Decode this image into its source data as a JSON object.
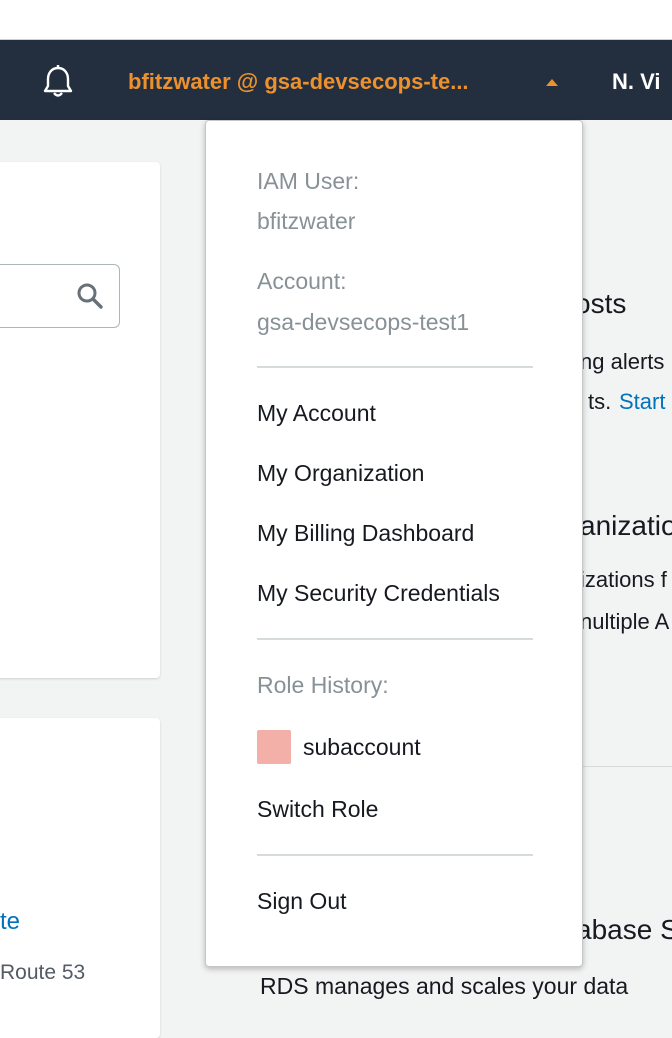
{
  "topnav": {
    "account_label": "bfitzwater @ gsa-devsecops-te...",
    "region_label": "N. Vi",
    "accent_color": "#ec912d",
    "background_color": "#232f3e"
  },
  "icons": {
    "notifications": "bell-icon",
    "search": "search-icon",
    "expand": "caret-up-icon"
  },
  "background": {
    "costs_heading": "osts",
    "costs_line1": "ng alerts",
    "costs_line2": "ts.",
    "costs_link": "Start",
    "org_heading": "anizatio",
    "org_line1": "izations f",
    "org_line2": "nultiple A",
    "link_fragment": "te",
    "route_fragment": "Route 53",
    "db_heading": "abase S",
    "rds_text": "RDS manages and scales your data"
  },
  "dropdown": {
    "iam_user_label": "IAM User:",
    "iam_user_value": "bfitzwater",
    "account_label": "Account:",
    "account_value": "gsa-devsecops-test1",
    "items": [
      "My Account",
      "My Organization",
      "My Billing Dashboard",
      "My Security Credentials"
    ],
    "role_history_label": "Role History:",
    "role_name": "subaccount",
    "role_color": "#f2b0a9",
    "switch_role": "Switch Role",
    "sign_out": "Sign Out"
  }
}
